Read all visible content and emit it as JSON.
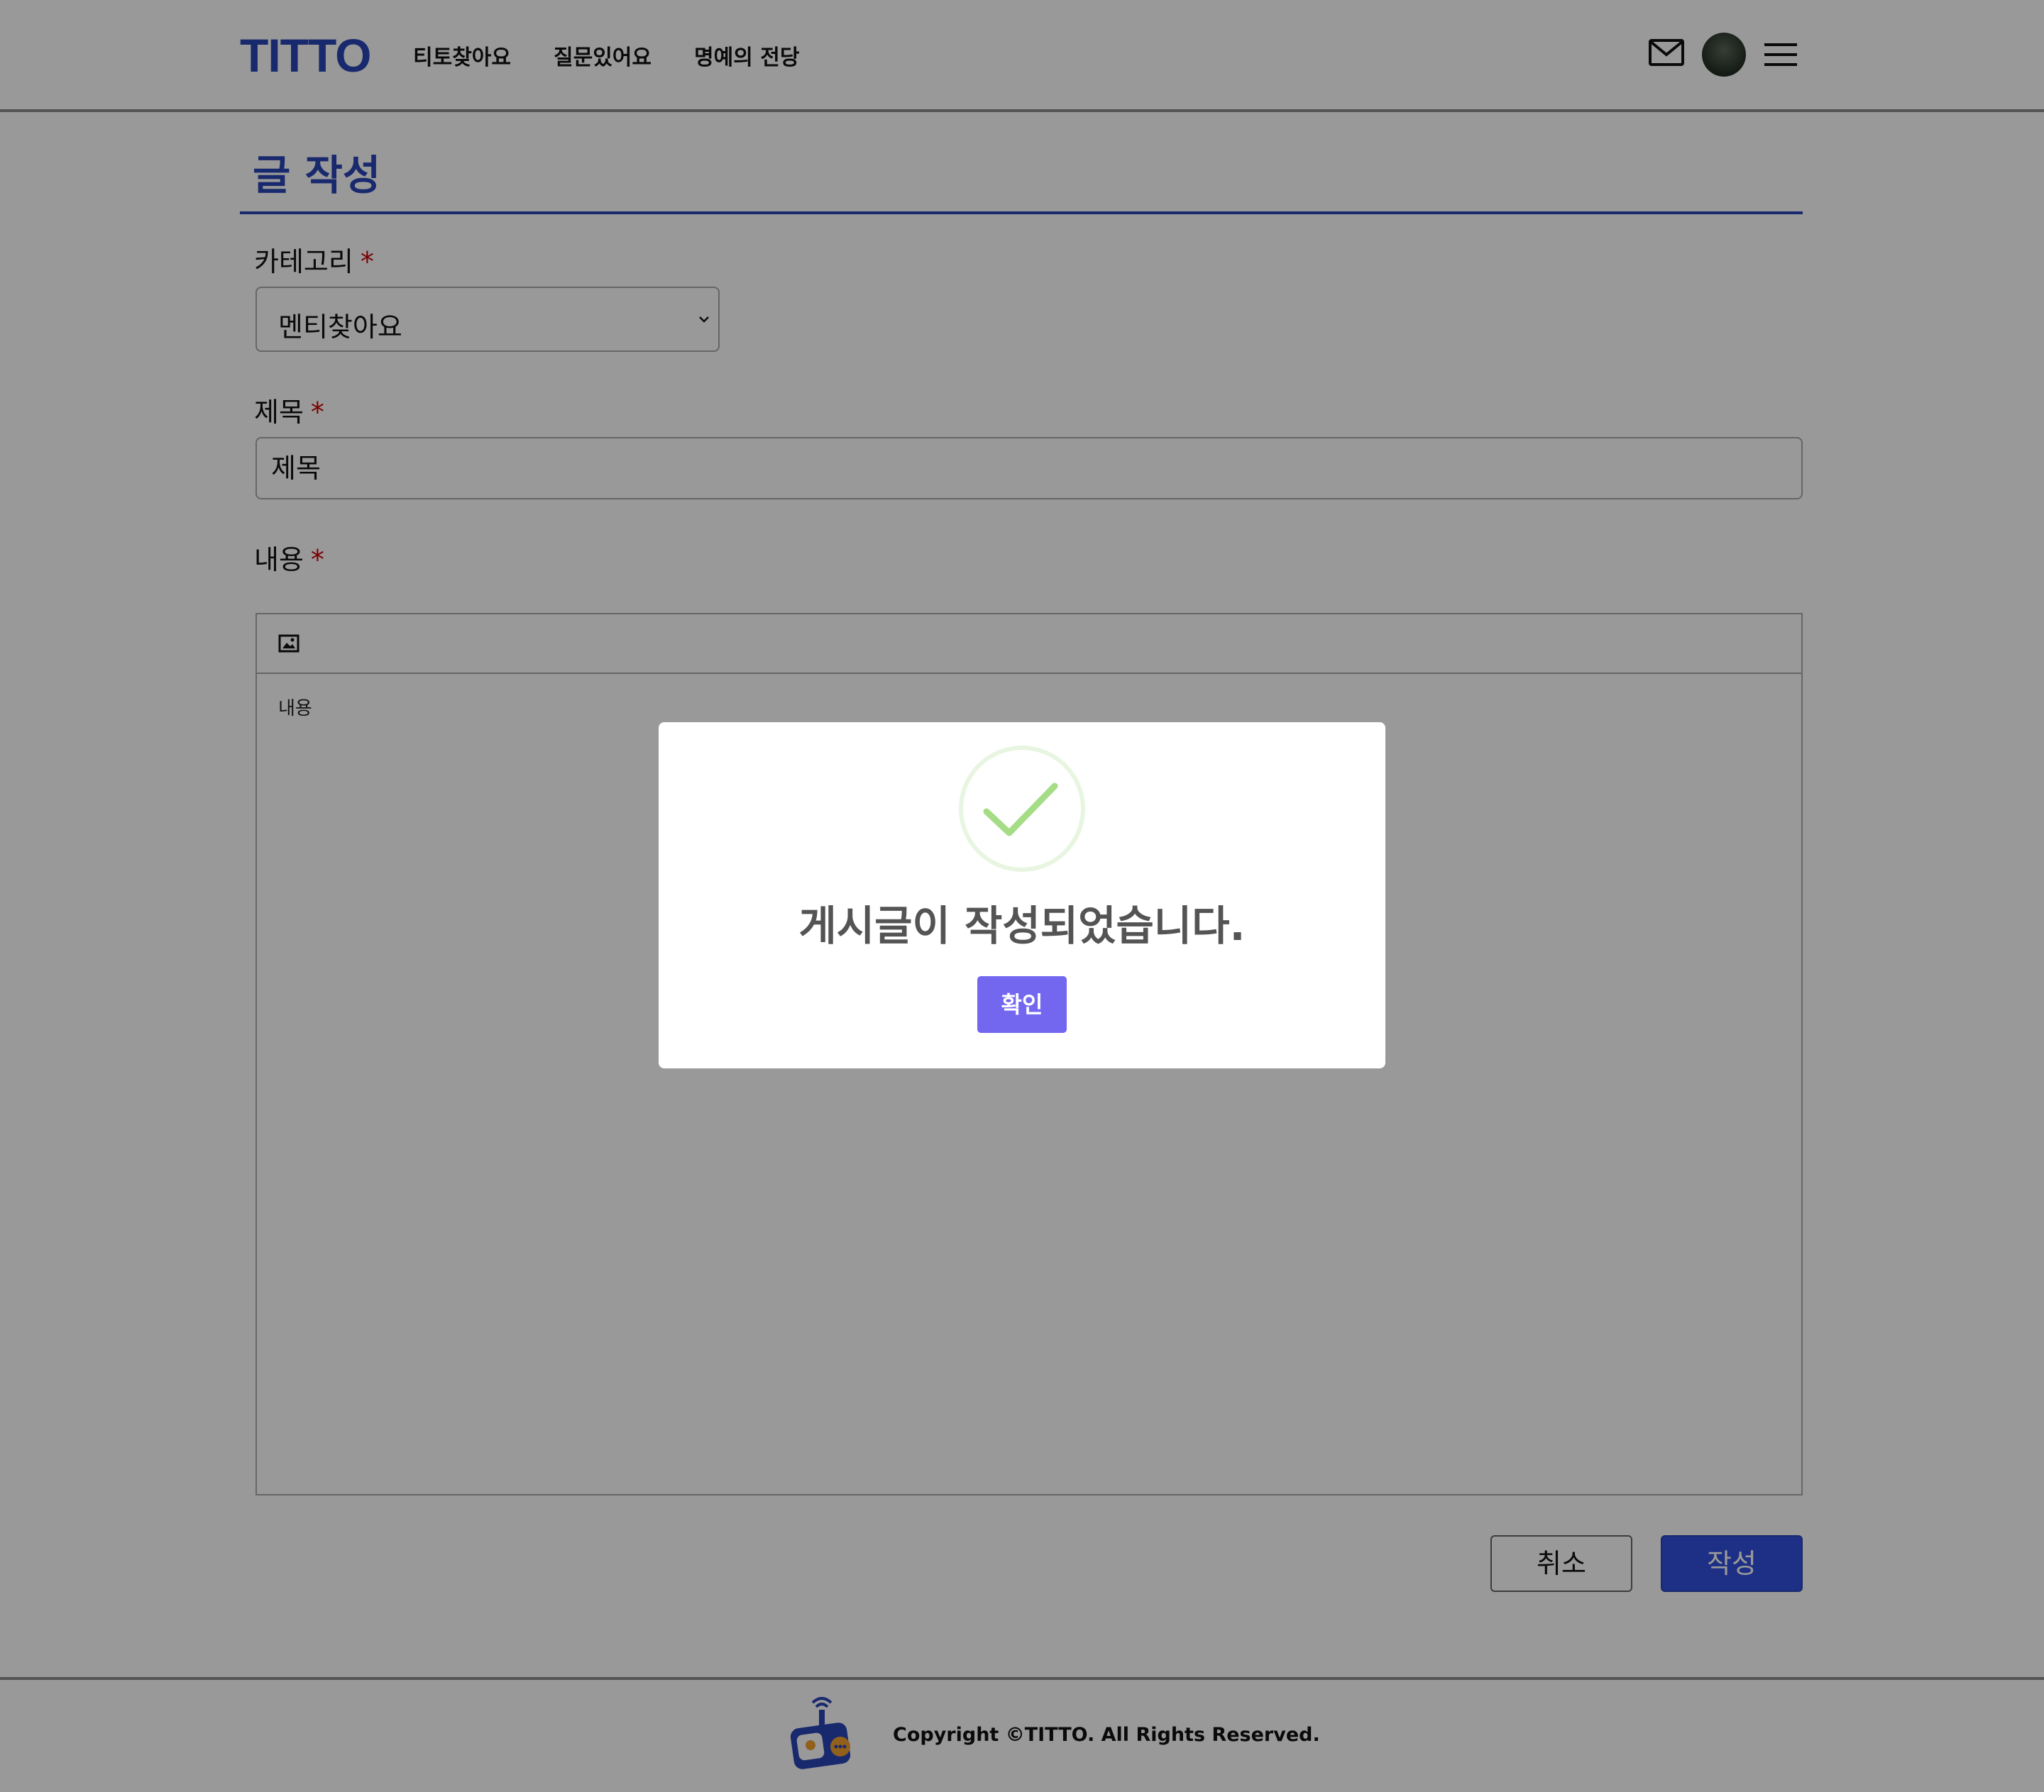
{
  "header": {
    "logo": "TITTO",
    "nav": [
      {
        "label": "티토찾아요"
      },
      {
        "label": "질문있어요"
      },
      {
        "label": "명예의 전당"
      }
    ]
  },
  "page": {
    "title": "글 작성"
  },
  "form": {
    "category_label": "카테고리",
    "category_value": "멘티찾아요",
    "title_label": "제목",
    "title_value": "제목",
    "content_label": "내용",
    "content_value": "내용",
    "required_mark": "*"
  },
  "actions": {
    "cancel_label": "취소",
    "submit_label": "작성"
  },
  "footer": {
    "copyright": "Copyright ©TITTO. All Rights Reserved."
  },
  "modal": {
    "message": "게시글이 작성되었습니다.",
    "confirm_label": "확인"
  },
  "colors": {
    "brand": "#2b45b8",
    "submit": "#3350e0",
    "required": "#cc0000",
    "modal_confirm": "#7367f0",
    "success_check": "#a5dc86"
  },
  "icons": {
    "mail": "mail-icon",
    "menu": "hamburger-menu-icon",
    "image": "image-icon",
    "success": "success-check-icon",
    "caret": "chevron-down-icon"
  }
}
